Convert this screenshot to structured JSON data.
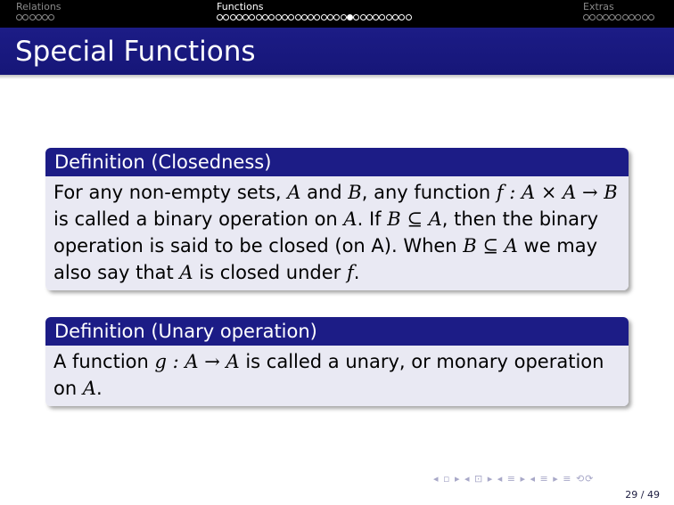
{
  "nav": {
    "sections": [
      {
        "label": "Relations",
        "dots": 6,
        "current": -1
      },
      {
        "label": "Functions",
        "dots": 30,
        "current": 20
      },
      {
        "label": "Extras",
        "dots": 11,
        "current": -1
      }
    ]
  },
  "slide": {
    "title": "Special Functions",
    "definition1": {
      "heading": "Definition (Closedness)",
      "line1": {
        "t1": "For any non-empty sets, ",
        "m1": "A",
        "t2": " and ",
        "m2": "B",
        "t3": ", any function ",
        "m3": "f : A × A → B"
      },
      "line2": {
        "t1": "is called a binary operation on ",
        "m1": "A",
        "t2": ".  If ",
        "m2": "B ⊆ A",
        "t3": ", then the binary"
      },
      "line3": {
        "t1": "operation is said to be closed (on A).  When ",
        "m1": "B ⊆ A",
        "t2": " we may"
      },
      "line4": {
        "t1": "also say that ",
        "m1": "A",
        "t2": " is closed under ",
        "m2": "f",
        "t3": "."
      }
    },
    "definition2": {
      "heading": "Definition (Unary operation)",
      "line1": {
        "t1": "A function ",
        "m1": "g : A → A",
        "t2": " is called a unary, or monary operation"
      },
      "line2": {
        "t1": "on ",
        "m1": "A",
        "t2": "."
      }
    }
  },
  "footer": {
    "nav_symbols": "◂ ▫ ▸ ◂ ⊡ ▸ ◂ ≡ ▸ ◂ ≡ ▸   ≡   ⟲⟳",
    "page_number": "29 / 49"
  }
}
